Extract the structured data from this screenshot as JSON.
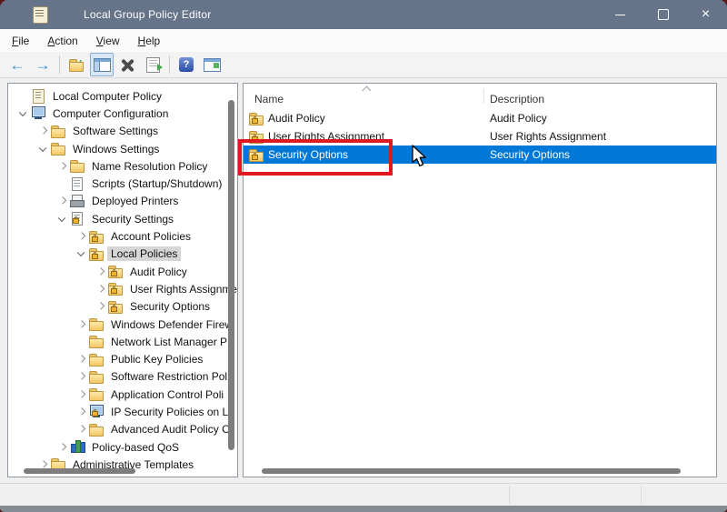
{
  "window": {
    "title": "Local Group Policy Editor"
  },
  "menu": {
    "items": [
      {
        "label": "File"
      },
      {
        "label": "Action"
      },
      {
        "label": "View"
      },
      {
        "label": "Help"
      }
    ]
  },
  "toolbar": {
    "buttons": [
      {
        "name": "back"
      },
      {
        "name": "forward"
      },
      {
        "name": "up-one-level"
      },
      {
        "name": "show-console-tree",
        "pressed": true
      },
      {
        "name": "delete"
      },
      {
        "name": "export-list"
      },
      {
        "name": "help"
      },
      {
        "name": "show-action-pane"
      }
    ]
  },
  "tree": {
    "items": [
      {
        "label": "Local Computer Policy",
        "level": 0,
        "icon": "gpo-scroll",
        "expander": "none"
      },
      {
        "label": "Computer Configuration",
        "level": 1,
        "icon": "computer",
        "expander": "expanded"
      },
      {
        "label": "Software Settings",
        "level": 2,
        "icon": "folder",
        "expander": "collapsed"
      },
      {
        "label": "Windows Settings",
        "level": 2,
        "icon": "folder",
        "expander": "expanded"
      },
      {
        "label": "Name Resolution Policy",
        "level": 3,
        "icon": "folder",
        "expander": "collapsed"
      },
      {
        "label": "Scripts (Startup/Shutdown)",
        "level": 3,
        "icon": "script",
        "expander": "none"
      },
      {
        "label": "Deployed Printers",
        "level": 3,
        "icon": "printer",
        "expander": "collapsed"
      },
      {
        "label": "Security Settings",
        "level": 3,
        "icon": "security-lock",
        "expander": "expanded"
      },
      {
        "label": "Account Policies",
        "level": 4,
        "icon": "folder-lock",
        "expander": "collapsed"
      },
      {
        "label": "Local Policies",
        "level": 4,
        "icon": "folder-lock",
        "expander": "expanded",
        "selected": true
      },
      {
        "label": "Audit Policy",
        "level": 5,
        "icon": "folder-lock",
        "expander": "collapsed"
      },
      {
        "label": "User Rights Assignme",
        "level": 5,
        "icon": "folder-lock",
        "expander": "collapsed"
      },
      {
        "label": "Security Options",
        "level": 5,
        "icon": "folder-lock",
        "expander": "collapsed"
      },
      {
        "label": "Windows Defender Firew",
        "level": 4,
        "icon": "folder",
        "expander": "collapsed"
      },
      {
        "label": "Network List Manager P",
        "level": 4,
        "icon": "folder",
        "expander": "none"
      },
      {
        "label": "Public Key Policies",
        "level": 4,
        "icon": "folder",
        "expander": "collapsed"
      },
      {
        "label": "Software Restriction Pol",
        "level": 4,
        "icon": "folder",
        "expander": "collapsed"
      },
      {
        "label": "Application Control Poli",
        "level": 4,
        "icon": "folder",
        "expander": "collapsed"
      },
      {
        "label": "IP Security Policies on Lo",
        "level": 4,
        "icon": "ipsec-computer-lock",
        "expander": "collapsed"
      },
      {
        "label": "Advanced Audit Policy C",
        "level": 4,
        "icon": "folder",
        "expander": "collapsed"
      },
      {
        "label": "Policy-based QoS",
        "level": 3,
        "icon": "qos-chart",
        "expander": "collapsed"
      },
      {
        "label": "Administrative Templates",
        "level": 2,
        "icon": "folder",
        "expander": "collapsed"
      }
    ]
  },
  "list": {
    "columns": [
      {
        "label": "Name",
        "sort": "ascending"
      },
      {
        "label": "Description"
      }
    ],
    "rows": [
      {
        "name": "Audit Policy",
        "description": "Audit Policy",
        "icon": "folder-lock"
      },
      {
        "name": "User Rights Assignment",
        "description": "User Rights Assignment",
        "icon": "folder-lock"
      },
      {
        "name": "Security Options",
        "description": "Security Options",
        "icon": "folder-lock",
        "selected": true
      }
    ]
  },
  "annotation": {
    "type": "highlight-box",
    "color": "#e0191f",
    "target": "Security Options"
  },
  "colors": {
    "titlebar": "#66748a",
    "selection_blue": "#0078d7",
    "tree_selection_gray": "#d6d6d6",
    "chrome": "#f0f0f0",
    "bottom_border": "#848b93",
    "desktop_corner": "#5c1616"
  }
}
